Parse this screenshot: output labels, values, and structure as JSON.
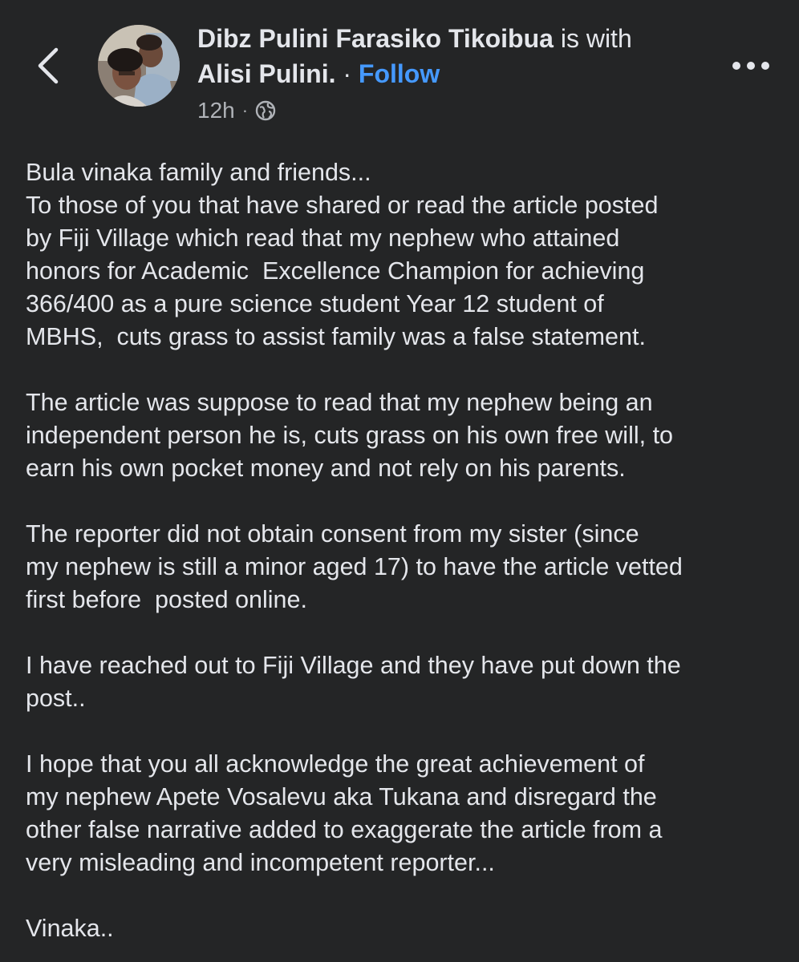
{
  "header": {
    "author_name": "Dibz Pulini Farasiko Tikoibua",
    "with_text": " is with",
    "tagged_name": "Alisi Pulini.",
    "separator": " · ",
    "follow_label": "Follow",
    "timestamp": "12h",
    "meta_separator": "·",
    "privacy_icon": "globe-icon",
    "back_icon": "chevron-left-icon",
    "more_icon": "more-horizontal-icon"
  },
  "post": {
    "paragraphs": [
      [
        "Bula vinaka family and friends...",
        "To those of you that have shared or read the article posted",
        "by Fiji Village which read that my nephew who attained",
        "honors for Academic  Excellence Champion for achieving",
        "366/400 as a pure science student Year 12 student of",
        "MBHS,  cuts grass to assist family was a false statement."
      ],
      [
        "The article was suppose to read that my nephew being an",
        "independent person he is, cuts grass on his own free will, to",
        "earn his own pocket money and not rely on his parents."
      ],
      [
        "The reporter did not obtain consent from my sister (since",
        "my nephew is still a minor aged 17) to have the article vetted",
        "first before  posted online."
      ],
      [
        "I have reached out to Fiji Village and they have put down the",
        "post.."
      ],
      [
        "I hope that you all acknowledge the great achievement of",
        "my nephew Apete Vosalevu aka Tukana and disregard the",
        "other false narrative added to exaggerate the article from a",
        "very misleading and incompetent reporter..."
      ],
      [
        "Vinaka.."
      ]
    ]
  },
  "colors": {
    "background": "#242526",
    "text_primary": "#e4e6eb",
    "text_secondary": "#b0b3b8",
    "link_blue": "#4599ff"
  }
}
